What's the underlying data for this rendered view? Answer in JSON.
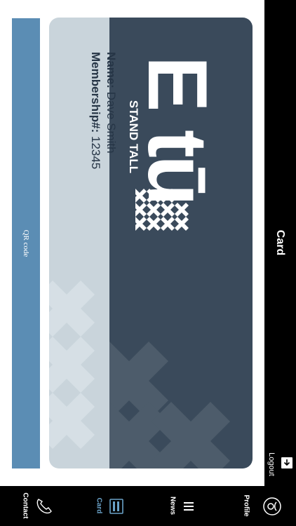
{
  "header": {
    "title": "Card",
    "logout_label": "Logout"
  },
  "card": {
    "logo_text": "E tū",
    "tagline": "STAND TALL",
    "name_label": "Name:",
    "name_value": "Dave Smith",
    "membership_label": "Membership#:",
    "membership_value": "12345"
  },
  "qr": {
    "label": "QR code"
  },
  "tabs": [
    {
      "label": "Profile",
      "icon": "profile-icon"
    },
    {
      "label": "News",
      "icon": "news-icon"
    },
    {
      "label": "Card",
      "icon": "card-icon",
      "active": true
    },
    {
      "label": "Contact",
      "icon": "phone-icon"
    }
  ],
  "colors": {
    "bar": "#000000",
    "card_dark": "#3a4a5b",
    "card_light": "#c9d4db",
    "qr_strip": "#5b8db4",
    "active_tab": "#6aa2c8"
  }
}
